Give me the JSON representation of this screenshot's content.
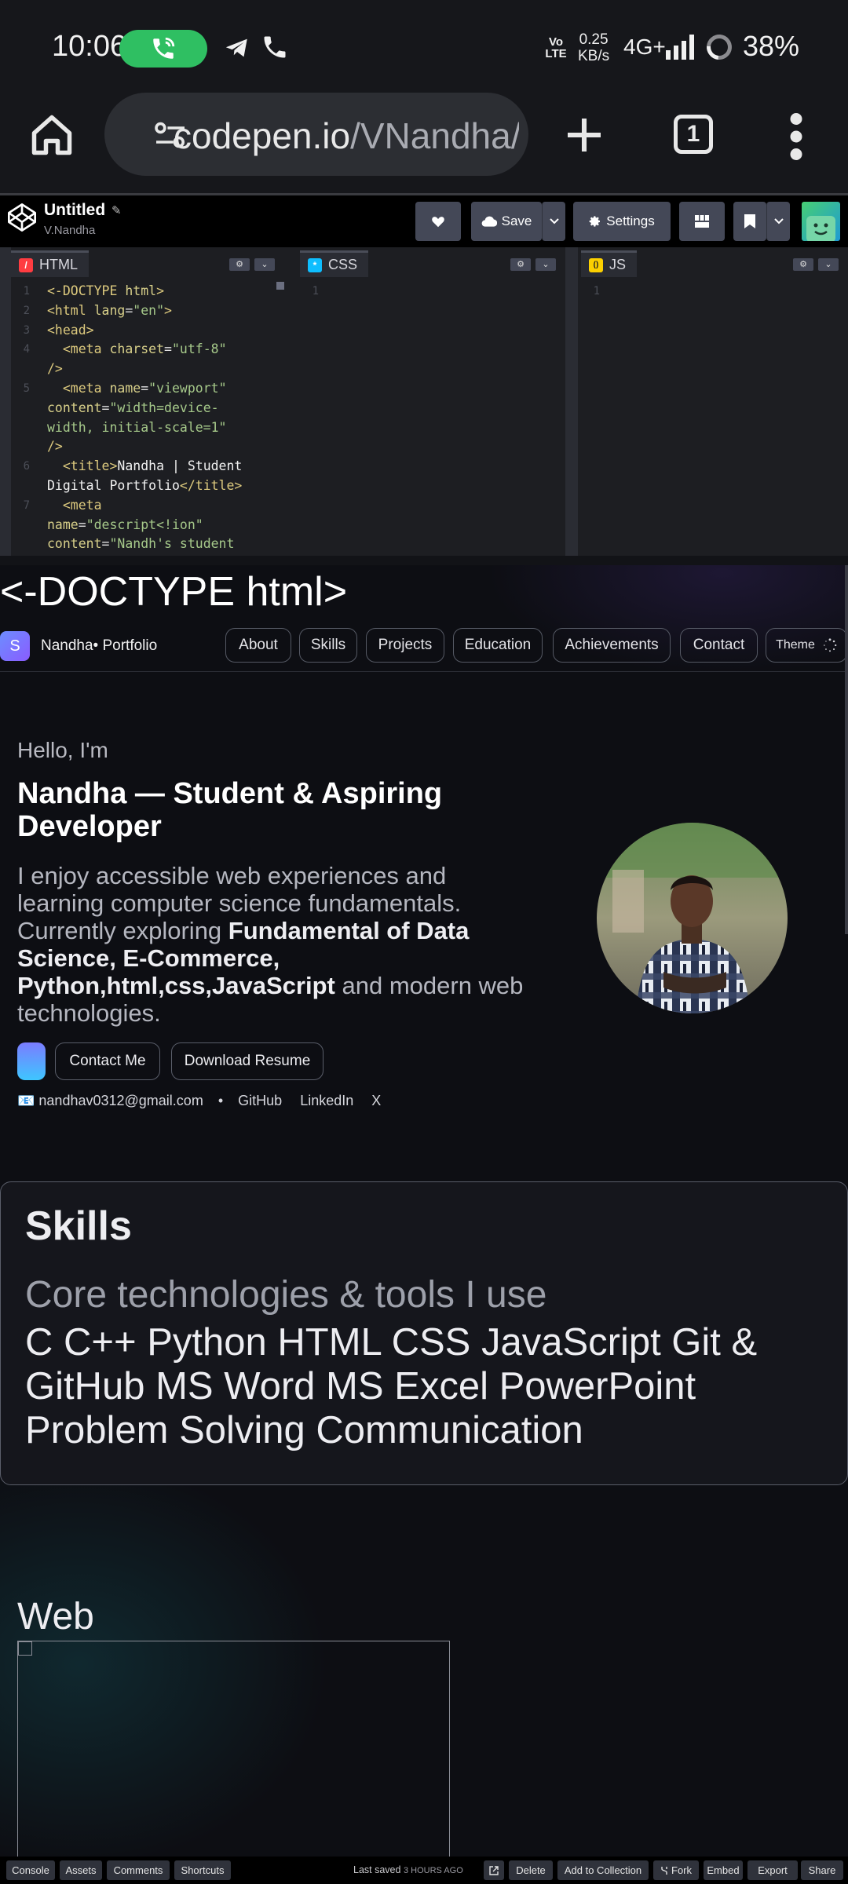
{
  "status_bar": {
    "time": "10:06",
    "volte": "Vo LTE",
    "speed_value": "0.25",
    "speed_unit": "KB/s",
    "network": "4G+",
    "battery": "38%",
    "call_color": "#2fbf62"
  },
  "browser": {
    "url_host": "codepen.io",
    "url_path": "/VNandha/",
    "tab_count": "1"
  },
  "codepen": {
    "pen_title": "Untitled",
    "author": "V.Nandha",
    "save_label": "Save",
    "settings_label": "Settings",
    "panes": [
      {
        "label": "HTML",
        "badge": "/",
        "badge_color": "#ff3c41"
      },
      {
        "label": "CSS",
        "badge": "*",
        "badge_color": "#0ebeff"
      },
      {
        "label": "JS",
        "badge": "()",
        "badge_color": "#fcd000"
      }
    ],
    "html_code": {
      "line_numbers": [
        "1",
        "2",
        "3",
        "4",
        "",
        "5",
        "",
        "",
        "6",
        "",
        "7",
        "",
        ""
      ],
      "empty_line_number": "1"
    },
    "footer": {
      "console": "Console",
      "assets": "Assets",
      "comments": "Comments",
      "shortcuts": "Shortcuts",
      "last_saved": "Last saved",
      "last_saved_time": "3 HOURS AGO",
      "delete": "Delete",
      "add_to_collection": "Add to Collection",
      "fork": "Fork",
      "embed": "Embed",
      "export": "Export",
      "share": "Share"
    }
  },
  "preview": {
    "doctype_text": "<-DOCTYPE html>",
    "brand_initial": "S",
    "brand": "Nandha• Portfolio",
    "nav": [
      "About",
      "Skills",
      "Projects",
      "Education",
      "Achievements",
      "Contact"
    ],
    "theme_label": "Theme",
    "hello": "Hello, I'm",
    "headline": "Nandha — Student & Aspiring Developer",
    "intro_a": "I enjoy accessible web experiences and learning computer science fundamentals. Currently exploring ",
    "intro_bold": "Fundamental of Data Science, E-Commerce, Python,html,css,JavaScript",
    "intro_b": " and modern web technologies.",
    "contact_button": "Contact Me",
    "resume_button": "Download Resume",
    "email": "📧 nandhav0312@gmail.com",
    "bullet": "•",
    "github": "GitHub",
    "linkedin": "LinkedIn",
    "x": "X",
    "skills_title": "Skills",
    "skills_subtitle": "Core technologies & tools I use",
    "skills_list": "C C++ Python HTML CSS JavaScript Git & GitHub MS Word MS Excel PowerPoint Problem Solving Communication",
    "web_heading": "Web"
  }
}
